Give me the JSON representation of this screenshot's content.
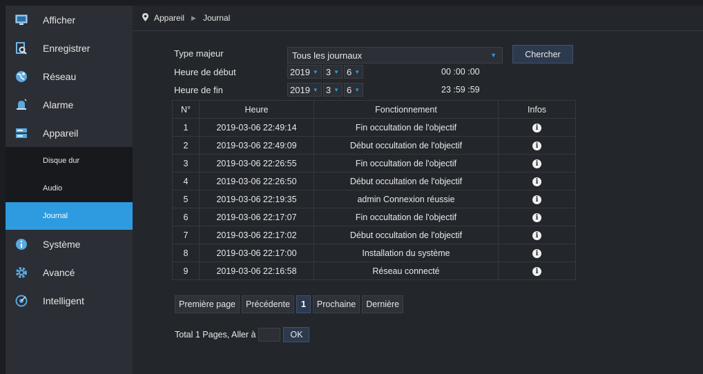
{
  "sidebar": {
    "items": [
      {
        "label": "Afficher",
        "icon": "monitor-icon"
      },
      {
        "label": "Enregistrer",
        "icon": "record-search-icon"
      },
      {
        "label": "Réseau",
        "icon": "network-globe-icon"
      },
      {
        "label": "Alarme",
        "icon": "alarm-bell-icon"
      },
      {
        "label": "Appareil",
        "icon": "device-hdd-icon"
      }
    ],
    "subitems": [
      {
        "label": "Disque dur"
      },
      {
        "label": "Audio"
      },
      {
        "label": "Journal"
      }
    ],
    "items2": [
      {
        "label": "Système",
        "icon": "info-circle-icon"
      },
      {
        "label": "Avancé",
        "icon": "gear-icon"
      },
      {
        "label": "Intelligent",
        "icon": "intelligent-icon"
      }
    ],
    "accent": "#2e9be0"
  },
  "breadcrumb": {
    "parent": "Appareil",
    "current": "Journal"
  },
  "filters": {
    "type_label": "Type majeur",
    "type_value": "Tous les journaux",
    "search_label": "Chercher",
    "start_label": "Heure de début",
    "end_label": "Heure de fin",
    "start": {
      "year": "2019",
      "month": "3",
      "day": "6",
      "time": "00 :00 :00"
    },
    "end": {
      "year": "2019",
      "month": "3",
      "day": "6",
      "time": "23 :59 :59"
    }
  },
  "table": {
    "headers": [
      "N°",
      "Heure",
      "Fonctionnement",
      "Infos"
    ],
    "rows": [
      {
        "n": "1",
        "time": "2019-03-06 22:49:14",
        "op": "Fin occultation de l'objectif"
      },
      {
        "n": "2",
        "time": "2019-03-06 22:49:09",
        "op": "Début occultation de l'objectif"
      },
      {
        "n": "3",
        "time": "2019-03-06 22:26:55",
        "op": "Fin occultation de l'objectif"
      },
      {
        "n": "4",
        "time": "2019-03-06 22:26:50",
        "op": "Début occultation de l'objectif"
      },
      {
        "n": "5",
        "time": "2019-03-06 22:19:35",
        "op": "admin Connexion réussie"
      },
      {
        "n": "6",
        "time": "2019-03-06 22:17:07",
        "op": "Fin occultation de l'objectif"
      },
      {
        "n": "7",
        "time": "2019-03-06 22:17:02",
        "op": "Début occultation de l'objectif"
      },
      {
        "n": "8",
        "time": "2019-03-06 22:17:00",
        "op": "Installation du système"
      },
      {
        "n": "9",
        "time": "2019-03-06 22:16:58",
        "op": "Réseau connecté"
      }
    ]
  },
  "pager": {
    "first": "Première page",
    "prev": "Précédente",
    "current": "1",
    "next": "Prochaine",
    "last": "Dernière",
    "total": "Total 1 Pages, Aller à",
    "ok": "OK"
  }
}
